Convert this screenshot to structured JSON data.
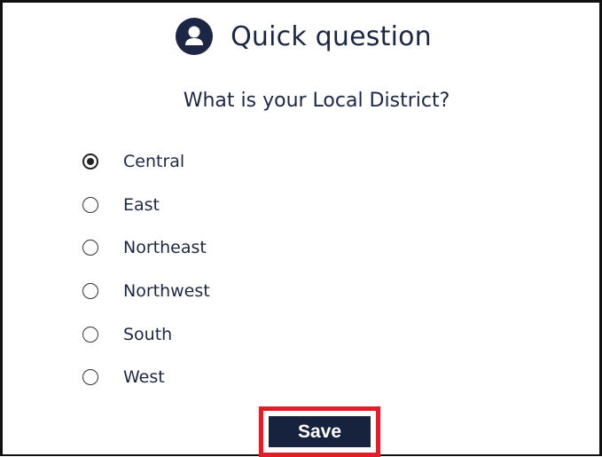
{
  "header": {
    "title": "Quick question",
    "icon": "user-avatar-icon"
  },
  "question": "What is your Local District?",
  "options": [
    {
      "label": "Central",
      "checked": true
    },
    {
      "label": "East",
      "checked": false
    },
    {
      "label": "Northeast",
      "checked": false
    },
    {
      "label": "Northwest",
      "checked": false
    },
    {
      "label": "South",
      "checked": false
    },
    {
      "label": "West",
      "checked": false
    }
  ],
  "save_label": "Save",
  "colors": {
    "navy": "#1b2744",
    "button": "#17223e",
    "highlight": "#e11d2a"
  }
}
